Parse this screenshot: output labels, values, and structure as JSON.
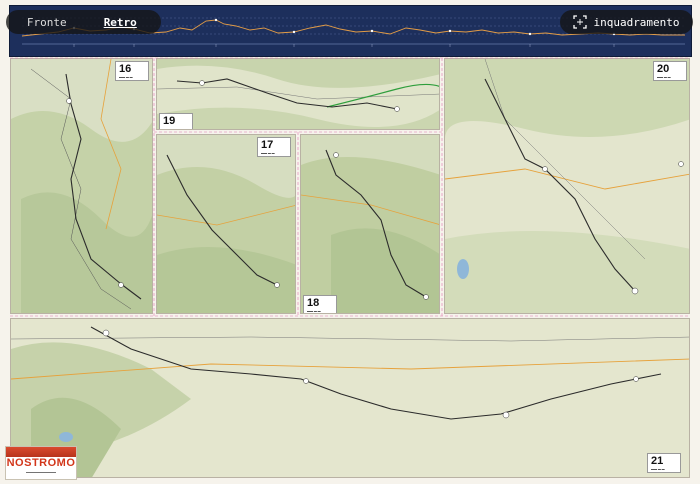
{
  "toolbar": {
    "front_label": "Fronte",
    "back_label": "Retro",
    "framing_label": "inquadramento",
    "framing_icon": "frame-corners-icon",
    "active_side": "back"
  },
  "stages": [
    {
      "id": "16",
      "label": "16"
    },
    {
      "id": "17",
      "label": "17"
    },
    {
      "id": "18",
      "label": "18"
    },
    {
      "id": "19",
      "label": "19"
    },
    {
      "id": "20",
      "label": "20"
    },
    {
      "id": "21",
      "label": "21"
    }
  ],
  "logo": {
    "name": "NOSTROMO"
  },
  "colors": {
    "profile_bg": "#1d2f5c",
    "route_line": "#2b2b2b",
    "green_route": "#2e9e3c",
    "logo_red": "#d2361a",
    "page_grid": "#e07bb0"
  }
}
